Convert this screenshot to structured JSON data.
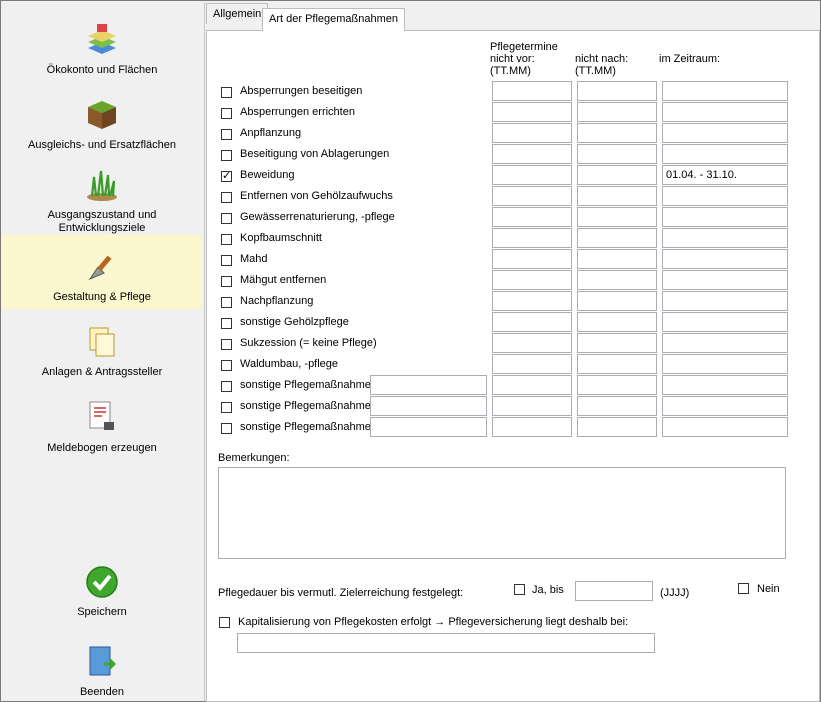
{
  "sidebar": {
    "items": [
      {
        "label": "Ökokonto und Flächen"
      },
      {
        "label": "Ausgleichs- und Ersatzflächen"
      },
      {
        "label": "Ausgangszustand und\nEntwicklungsziele"
      },
      {
        "label": "Gestaltung & Pflege"
      },
      {
        "label": "Anlagen & Antragssteller"
      },
      {
        "label": "Meldebogen erzeugen"
      }
    ],
    "save_label": "Speichern",
    "exit_label": "Beenden"
  },
  "tabs": [
    {
      "label": "Allgemein"
    },
    {
      "label": "Art der Pflegemaßnahmen"
    }
  ],
  "headers": {
    "pflegetermine": "Pflegetermine",
    "nicht_vor": "nicht vor:",
    "nicht_vor_fmt": "(TT.MM)",
    "nicht_nach": "nicht nach:",
    "nicht_nach_fmt": "(TT.MM)",
    "zeitraum": "im Zeitraum:"
  },
  "measures": [
    {
      "label": "Absperrungen beseitigen",
      "checked": false,
      "nicht_vor": "",
      "nicht_nach": "",
      "zeitraum": ""
    },
    {
      "label": "Absperrungen errichten",
      "checked": false,
      "nicht_vor": "",
      "nicht_nach": "",
      "zeitraum": ""
    },
    {
      "label": "Anpflanzung",
      "checked": false,
      "nicht_vor": "",
      "nicht_nach": "",
      "zeitraum": ""
    },
    {
      "label": "Beseitigung von Ablagerungen",
      "checked": false,
      "nicht_vor": "",
      "nicht_nach": "",
      "zeitraum": ""
    },
    {
      "label": "Beweidung",
      "checked": true,
      "nicht_vor": "",
      "nicht_nach": "",
      "zeitraum": "01.04. - 31.10."
    },
    {
      "label": "Entfernen von Gehölzaufwuchs",
      "checked": false,
      "nicht_vor": "",
      "nicht_nach": "",
      "zeitraum": ""
    },
    {
      "label": "Gewässerrenaturierung, -pflege",
      "checked": false,
      "nicht_vor": "",
      "nicht_nach": "",
      "zeitraum": ""
    },
    {
      "label": "Kopfbaumschnitt",
      "checked": false,
      "nicht_vor": "",
      "nicht_nach": "",
      "zeitraum": ""
    },
    {
      "label": "Mahd",
      "checked": false,
      "nicht_vor": "",
      "nicht_nach": "",
      "zeitraum": ""
    },
    {
      "label": "Mähgut entfernen",
      "checked": false,
      "nicht_vor": "",
      "nicht_nach": "",
      "zeitraum": ""
    },
    {
      "label": "Nachpflanzung",
      "checked": false,
      "nicht_vor": "",
      "nicht_nach": "",
      "zeitraum": ""
    },
    {
      "label": "sonstige Gehölzpflege",
      "checked": false,
      "nicht_vor": "",
      "nicht_nach": "",
      "zeitraum": ""
    },
    {
      "label": "Sukzession (= keine Pflege)",
      "checked": false,
      "nicht_vor": "",
      "nicht_nach": "",
      "zeitraum": ""
    },
    {
      "label": "Waldumbau, -pflege",
      "checked": false,
      "nicht_vor": "",
      "nicht_nach": "",
      "zeitraum": ""
    },
    {
      "label": "sonstige Pflegemaßnahme:",
      "checked": false,
      "other": true,
      "other_value": "",
      "nicht_vor": "",
      "nicht_nach": "",
      "zeitraum": ""
    },
    {
      "label": "sonstige Pflegemaßnahme:",
      "checked": false,
      "other": true,
      "other_value": "",
      "nicht_vor": "",
      "nicht_nach": "",
      "zeitraum": ""
    },
    {
      "label": "sonstige Pflegemaßnahme:",
      "checked": false,
      "other": true,
      "other_value": "",
      "nicht_vor": "",
      "nicht_nach": "",
      "zeitraum": ""
    }
  ],
  "remarks": {
    "label": "Bemerkungen:",
    "value": ""
  },
  "duration": {
    "label": "Pflegedauer bis vermutl. Zielerreichung festgelegt:",
    "yes_label": "Ja, bis",
    "year_value": "",
    "year_fmt": "(JJJJ)",
    "no_label": "Nein"
  },
  "capitalization": {
    "label": "Kapitalisierung von Pflegekosten erfolgt  →  Pflegeversicherung liegt deshalb bei:",
    "value": ""
  }
}
